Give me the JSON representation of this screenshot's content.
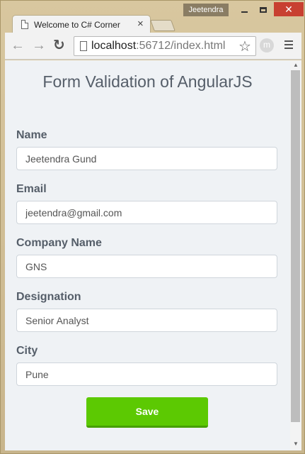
{
  "window": {
    "user": "Jeetendra",
    "minimize_icon": "minimize-icon",
    "maximize_icon": "maximize-icon",
    "close_glyph": "✕"
  },
  "tab": {
    "title": "Welcome to C# Corner",
    "close_glyph": "×"
  },
  "toolbar": {
    "back_glyph": "←",
    "forward_glyph": "→",
    "reload_glyph": "↻",
    "url_host": "localhost",
    "url_rest": ":56712/index.html",
    "star_glyph": "☆",
    "extension_letter": "m"
  },
  "page": {
    "title": "Form Validation of AngularJS",
    "fields": [
      {
        "label": "Name",
        "value": "Jeetendra Gund"
      },
      {
        "label": "Email",
        "value": "jeetendra@gmail.com"
      },
      {
        "label": "Company Name",
        "value": "GNS"
      },
      {
        "label": "Designation",
        "value": "Senior Analyst"
      },
      {
        "label": "City",
        "value": "Pune"
      }
    ],
    "save_label": "Save"
  },
  "colors": {
    "accent": "#5cc902",
    "label": "#555e69",
    "background": "#eff2f5",
    "close_button": "#c84031"
  }
}
